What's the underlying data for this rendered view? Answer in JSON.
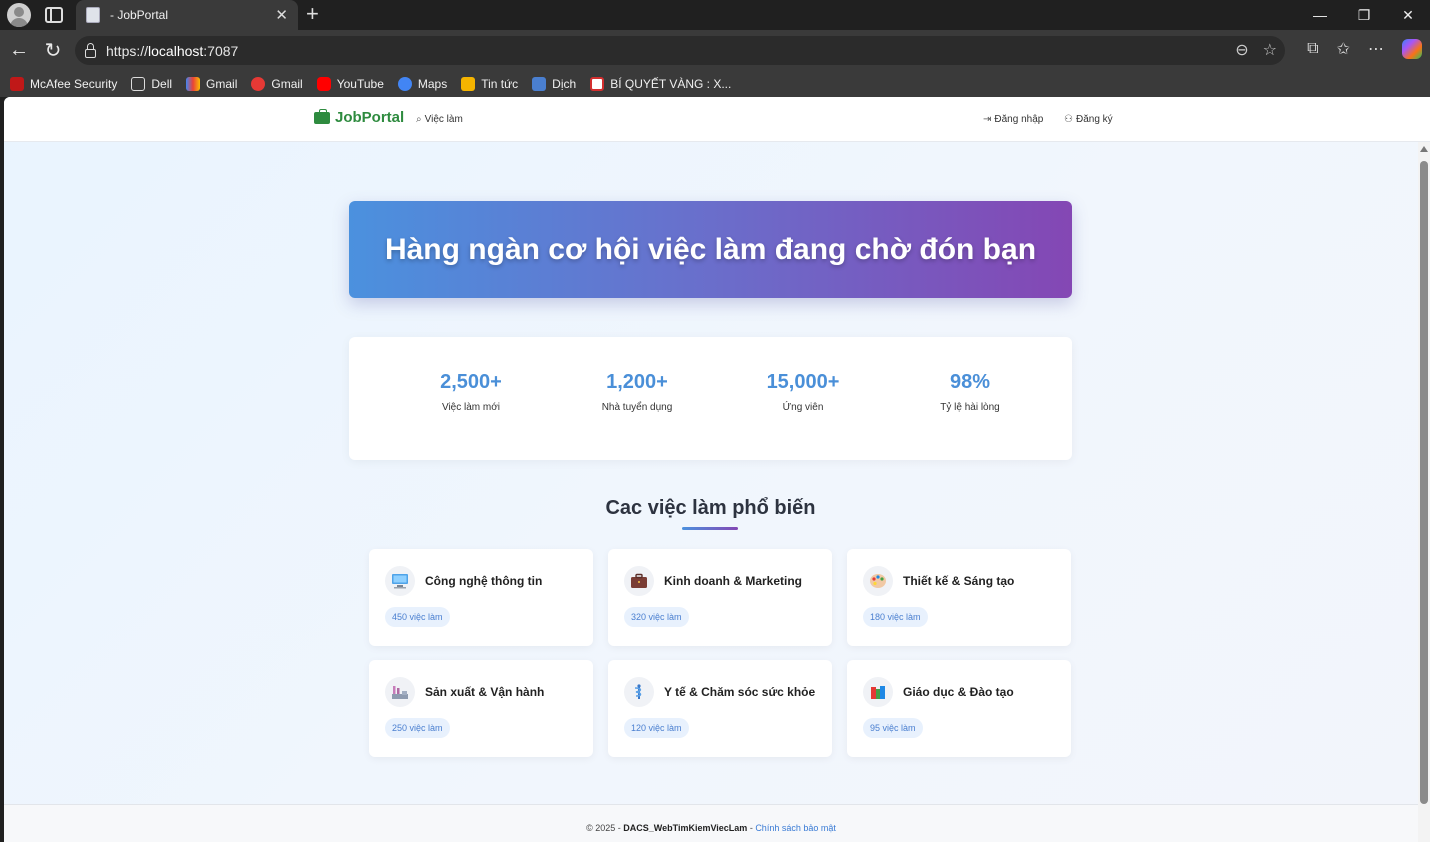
{
  "browser": {
    "tab_title": "- JobPortal",
    "url_scheme": "https://",
    "url_host": "localhost",
    "url_port": ":7087",
    "bookmarks": [
      {
        "label": "McAfee Security",
        "color": "#c01818"
      },
      {
        "label": "Dell",
        "color": "folder"
      },
      {
        "label": "Gmail",
        "color": "#ea4335"
      },
      {
        "label": "Gmail",
        "color": "#e53935"
      },
      {
        "label": "YouTube",
        "color": "#ff0000"
      },
      {
        "label": "Maps",
        "color": "#4285f4"
      },
      {
        "label": "Tin tức",
        "color": "#f5b400"
      },
      {
        "label": "Dịch",
        "color": "#4a7fd0"
      },
      {
        "label": "BÍ QUYẾT VÀNG : X...",
        "color": "#d32f2f"
      }
    ]
  },
  "site": {
    "brand": "JobPortal",
    "nav_jobs": "Việc làm",
    "login": "Đăng nhập",
    "register": "Đăng ký"
  },
  "hero": {
    "title": "Hàng ngàn cơ hội việc làm đang chờ đón bạn"
  },
  "stats": [
    {
      "value": "2,500+",
      "label": "Việc làm mới"
    },
    {
      "value": "1,200+",
      "label": "Nhà tuyển dụng"
    },
    {
      "value": "15,000+",
      "label": "Ứng viên"
    },
    {
      "value": "98%",
      "label": "Tỷ lệ hài lòng"
    }
  ],
  "section_title": "Cac việc làm phổ biến",
  "categories": [
    {
      "title": "Công nghệ thông tin",
      "count": "450 việc làm",
      "icon": "computer-icon"
    },
    {
      "title": "Kinh doanh & Marketing",
      "count": "320 việc làm",
      "icon": "briefcase-icon"
    },
    {
      "title": "Thiết kế & Sáng tạo",
      "count": "180 việc làm",
      "icon": "palette-icon"
    },
    {
      "title": "Sản xuất & Vận hành",
      "count": "250 việc làm",
      "icon": "factory-icon"
    },
    {
      "title": "Y tế & Chăm sóc sức khỏe",
      "count": "120 việc làm",
      "icon": "medical-icon"
    },
    {
      "title": "Giáo dục & Đào tạo",
      "count": "95 việc làm",
      "icon": "books-icon"
    }
  ],
  "footer": {
    "copyright": "© 2025 - ",
    "project": "DACS_WebTimKiemViecLam",
    "sep": " - ",
    "privacy": "Chính sách bảo mật"
  }
}
